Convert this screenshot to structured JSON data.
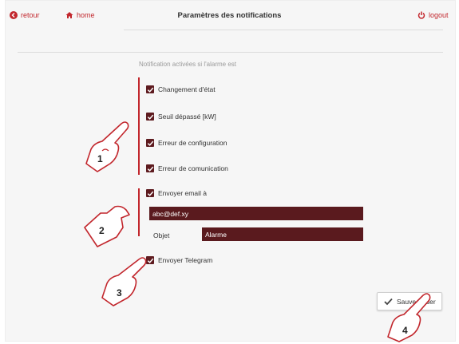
{
  "header": {
    "back_label": "retour",
    "home_label": "home",
    "title": "Paramètres des notifications",
    "logout_label": "logout"
  },
  "form": {
    "subtitle": "Notification activées si l'alarme est",
    "conditions": [
      {
        "label": "Changement d'état",
        "checked": true
      },
      {
        "label": "Seuil dépassé [kW]",
        "checked": true
      },
      {
        "label": "Erreur de configuration",
        "checked": true
      },
      {
        "label": "Erreur de comunication",
        "checked": true
      }
    ],
    "email": {
      "label": "Envoyer email à",
      "checked": true,
      "address": "abc@def.xy",
      "subject_label": "Objet",
      "subject_value": "Alarme"
    },
    "telegram": {
      "label": "Envoyer Telegram",
      "checked": true
    },
    "save_label": "Sauvegarder"
  },
  "annotations": [
    "1",
    "2",
    "3",
    "4"
  ],
  "colors": {
    "accent": "#c2272d",
    "field_bg": "#5a1a1e",
    "checkbox": "#5e1b1f"
  }
}
